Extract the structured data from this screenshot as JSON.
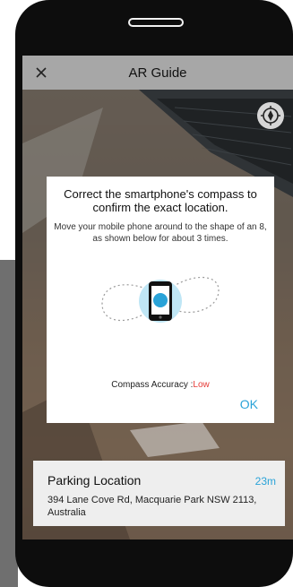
{
  "header": {
    "title": "AR Guide",
    "close_icon": "close-icon"
  },
  "toolbar": {
    "compass_icon": "compass-icon"
  },
  "dialog": {
    "title": "Correct the smartphone's compass to confirm the exact location.",
    "description": "Move your mobile phone around to the shape of an 8, as shown below for about 3 times.",
    "illustration_icon": "phone-figure-eight-icon",
    "accuracy_label": "Compass Accuracy :",
    "accuracy_value": "Low",
    "ok_label": "OK"
  },
  "parking": {
    "title": "Parking Location",
    "distance": "23m",
    "address": "394 Lane Cove Rd, Macquarie Park NSW 2113, Australia"
  },
  "colors": {
    "accent": "#2aa3d8",
    "accuracy_low": "#e53935",
    "illustration_circle": "#bfe6f5",
    "phone_frame": "#111111"
  }
}
